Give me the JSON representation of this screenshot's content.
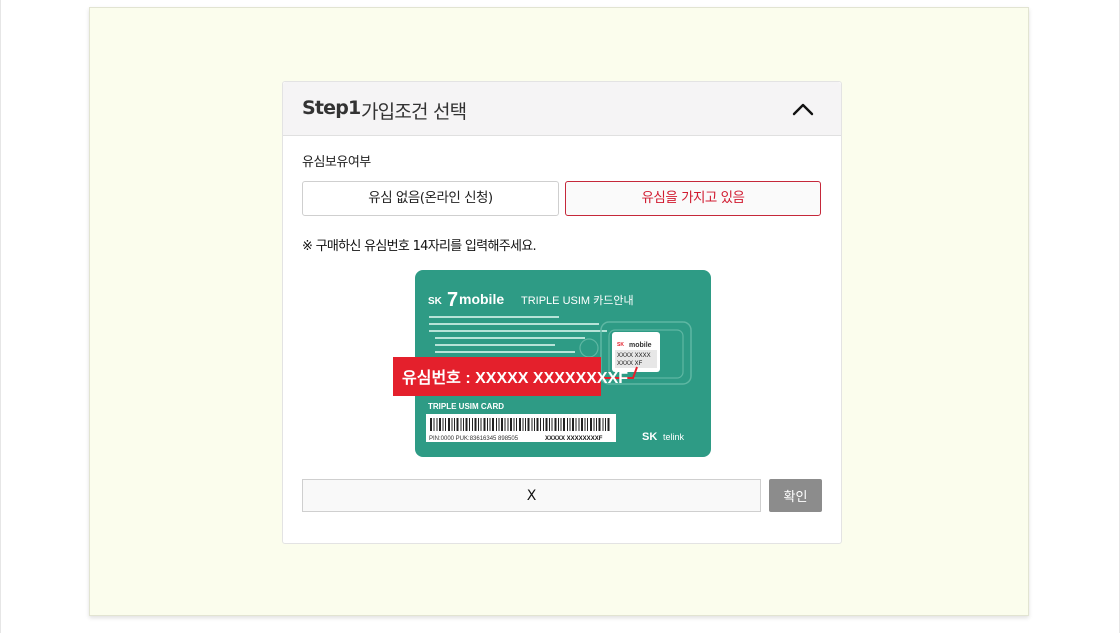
{
  "step": {
    "number": "Step1",
    "title": "가입조건 선택",
    "collapse_icon": "chevron-up-icon"
  },
  "usim_ownership": {
    "label": "유심보유여부",
    "options": [
      {
        "label": "유심 없음(온라인 신청)",
        "selected": false
      },
      {
        "label": "유심을 가지고 있음",
        "selected": true
      }
    ]
  },
  "notice": "※ 구매하신 유심번호 14자리를 입력해주세요.",
  "sim_card": {
    "brand_sk": "SK",
    "brand_mobile": "mobile",
    "title": "TRIPLE USIM 카드안내",
    "callout": "유심번호 : XXXXX XXXXXXXXF",
    "card_label": "TRIPLE USIM CARD",
    "code_line_prefix": "PIN:0000  PUK:83616345  898505",
    "code_line_highlight": "XXXXX XXXXXXXXF",
    "chip_brand": "mobile",
    "chip_number_1": "XXXX XXXX",
    "chip_number_2": "XXXX XF",
    "footer_logo_sk": "SK",
    "footer_logo_telink": "telink",
    "card_color": "#2e9b85",
    "callout_color": "#e4202c"
  },
  "sim_input": {
    "value": "X"
  },
  "confirm_label": "확인"
}
